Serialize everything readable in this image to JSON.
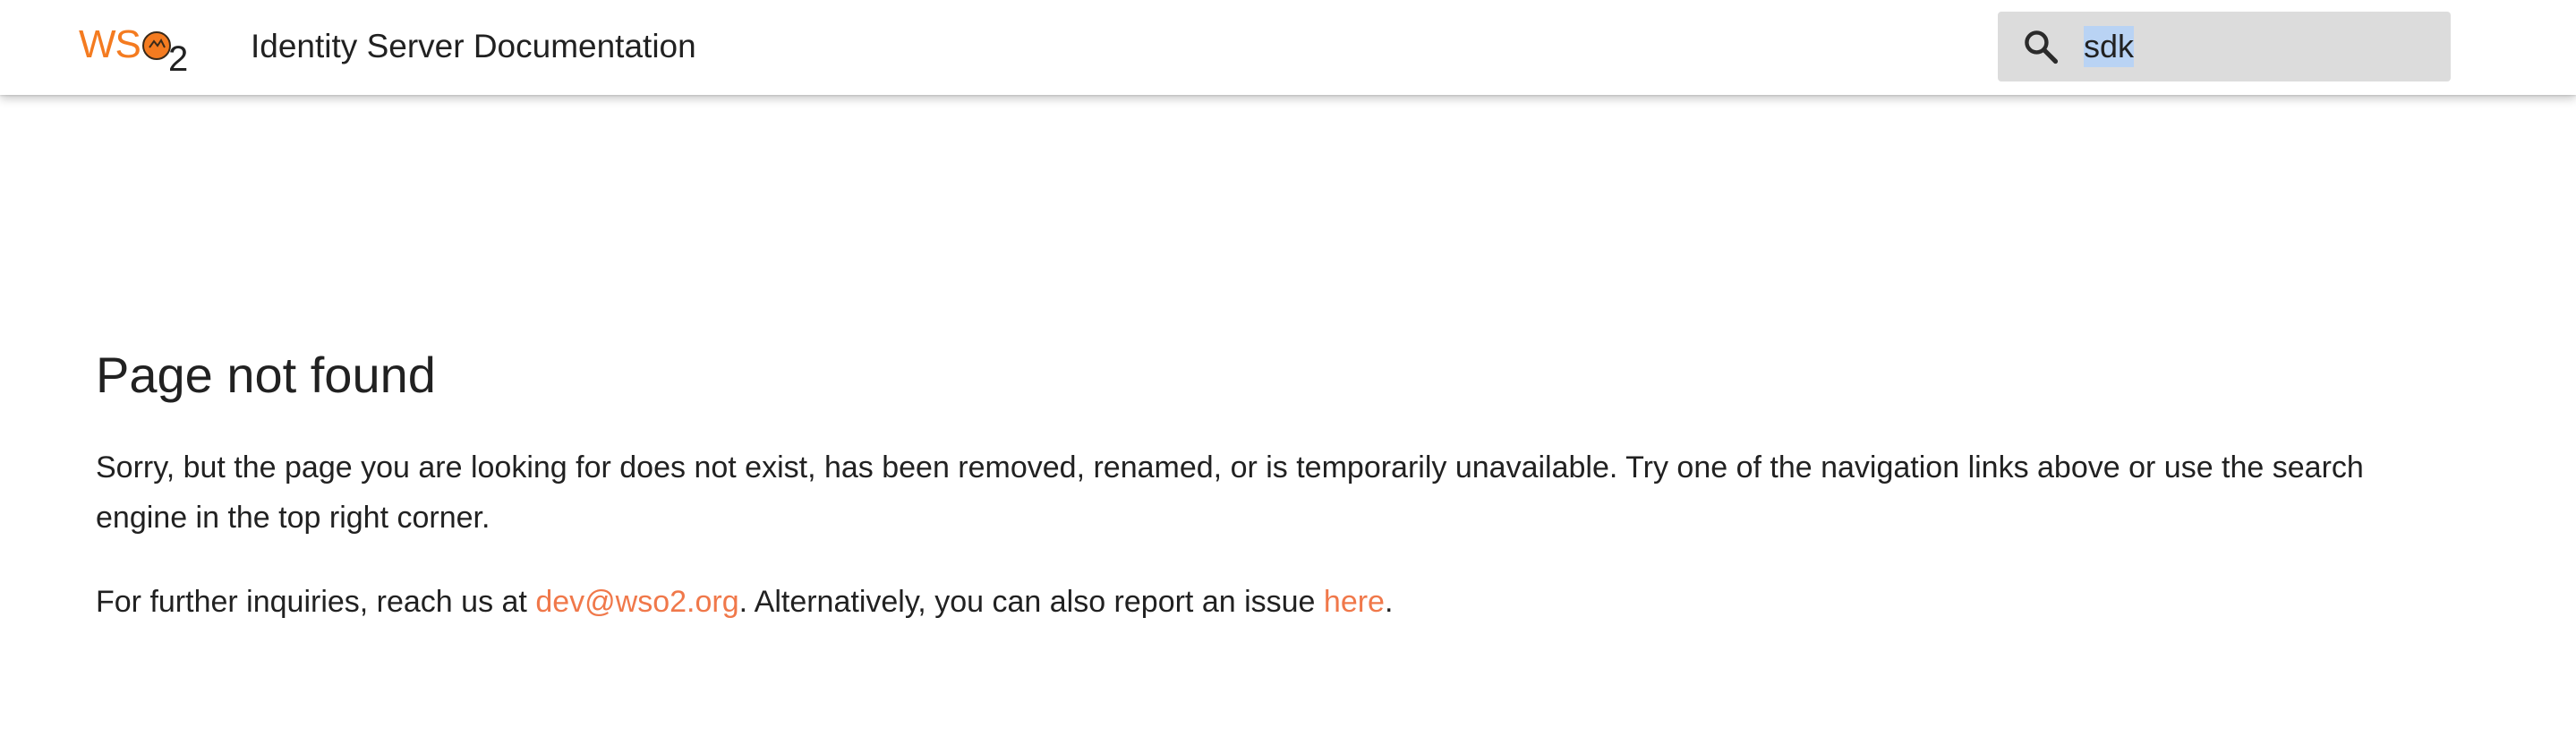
{
  "header": {
    "logo": {
      "text_ws": "WS",
      "text_o": "O",
      "text_2": "2",
      "brand_color": "#f47b20"
    },
    "site_title": "Identity Server Documentation",
    "search": {
      "value": "sdk",
      "icon": "search-icon",
      "selected": true
    }
  },
  "main": {
    "title": "Page not found",
    "paragraph1": "Sorry, but the page you are looking for does not exist, has been removed, renamed, or is temporarily unavailable. Try one of the navigation links above or use the search engine in the top right corner.",
    "paragraph2": {
      "prefix": "For further inquiries, reach us at ",
      "email_link": "dev@wso2.org",
      "middle": ". Alternatively, you can also report an issue ",
      "issue_link": "here",
      "suffix": "."
    },
    "link_color": "#f0784a"
  }
}
